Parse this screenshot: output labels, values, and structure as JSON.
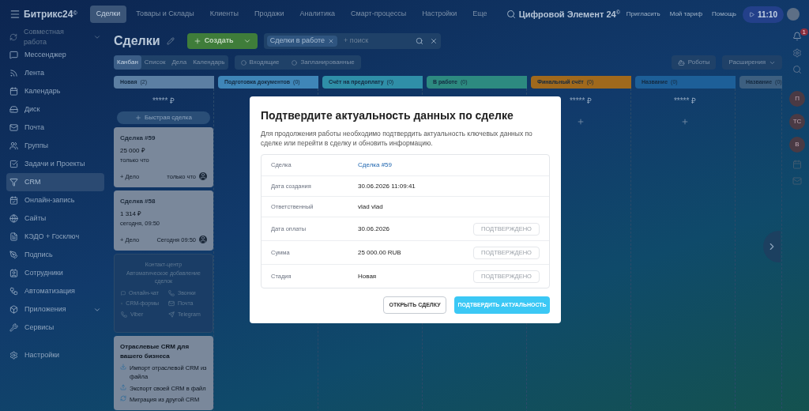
{
  "topbar": {
    "logo": "Битрикс24",
    "logo_mark": "©",
    "nav": [
      {
        "label": "Сделки",
        "selected": true
      },
      {
        "label": "Товары и Склады",
        "selected": false
      },
      {
        "label": "Клиенты",
        "selected": false
      },
      {
        "label": "Продажи",
        "selected": false
      },
      {
        "label": "Аналитика",
        "selected": false
      },
      {
        "label": "Смарт-процессы",
        "selected": false
      },
      {
        "label": "Настройки",
        "selected": false
      },
      {
        "label": "Еще",
        "selected": false
      }
    ],
    "company": "Цифровой Элемент 24",
    "company_mark": "©",
    "links": [
      "Пригласить",
      "Мой тариф",
      "Помощь"
    ],
    "time": "11:10"
  },
  "sidebar": {
    "group": "Совместная работа",
    "items": [
      {
        "label": "Мессенджер",
        "selected": false,
        "expandable": false
      },
      {
        "label": "Лента",
        "selected": false,
        "expandable": false
      },
      {
        "label": "Календарь",
        "selected": false,
        "expandable": false
      },
      {
        "label": "Диск",
        "selected": false,
        "expandable": false
      },
      {
        "label": "Почта",
        "selected": false,
        "expandable": false
      },
      {
        "label": "Группы",
        "selected": false,
        "expandable": false
      },
      {
        "label": "Задачи и Проекты",
        "selected": false,
        "expandable": false
      },
      {
        "label": "CRM",
        "selected": true,
        "expandable": false
      },
      {
        "label": "Онлайн-запись",
        "selected": false,
        "expandable": false
      },
      {
        "label": "Сайты",
        "selected": false,
        "expandable": false
      },
      {
        "label": "КЭДО + Госключ",
        "selected": false,
        "expandable": false
      },
      {
        "label": "Подпись",
        "selected": false,
        "expandable": false
      },
      {
        "label": "Сотрудники",
        "selected": false,
        "expandable": false
      },
      {
        "label": "Автоматизация",
        "selected": false,
        "expandable": false
      },
      {
        "label": "Приложения",
        "selected": false,
        "expandable": true
      },
      {
        "label": "Сервисы",
        "selected": false,
        "expandable": false
      }
    ],
    "settings": "Настройки"
  },
  "header": {
    "title": "Сделки",
    "create": "Создать",
    "filter_chip": "Сделки в работе",
    "search_placeholder": "+ поиск",
    "views": [
      {
        "label": "Канбан",
        "selected": true
      },
      {
        "label": "Список",
        "selected": false
      },
      {
        "label": "Дела",
        "selected": false
      },
      {
        "label": "Календарь",
        "selected": false
      }
    ],
    "counters": [
      "Входящие",
      "Запланированные"
    ],
    "robots": "Роботы",
    "extensions": "Расширения"
  },
  "stages": [
    {
      "name": "Новая",
      "count": "(2)",
      "color": "#5c7fa3",
      "sum": "***** ₽"
    },
    {
      "name": "Подготовка документов",
      "count": "(0)",
      "color": "#3f86b8"
    },
    {
      "name": "Счёт на предоплату",
      "count": "(0)",
      "color": "#2f8fa8"
    },
    {
      "name": "В работе",
      "count": "(0)",
      "color": "#2d8a80"
    },
    {
      "name": "Финальный счёт",
      "count": "(0)",
      "color": "#a0691c",
      "sum": "***** ₽"
    },
    {
      "name": "Название",
      "count": "(0)",
      "color": "#1d5f98",
      "sum": "***** ₽"
    },
    {
      "name": "Название",
      "count": "(0)",
      "color": "#3d5f80"
    }
  ],
  "quick_deal": "Быстрая сделка",
  "deals": [
    {
      "title": "Сделка #59",
      "amount": "25 000 ₽",
      "date": "только что",
      "add": "+ Дело",
      "time": "только что"
    },
    {
      "title": "Сделка #58",
      "amount": "1 314 ₽",
      "date": "сегодня, 09:50",
      "add": "+ Дело",
      "time": "Сегодня 09:50"
    }
  ],
  "contact_center": {
    "title": "Контакт-центр",
    "subtitle": "Автоматическое добавление сделок",
    "channels": [
      "Онлайн-чат",
      "Звонки",
      "CRM-формы",
      "Почта",
      "Viber",
      "Telegram"
    ]
  },
  "industry": {
    "title": "Отраслевые CRM для вашего бизнеса",
    "items": [
      "Импорт отраслевой CRM из файла",
      "Экспорт своей CRM в файл",
      "Миграция из другой CRM"
    ]
  },
  "right_rail": {
    "badge": "1",
    "avatars": [
      "П",
      "ТС",
      "В"
    ]
  },
  "dialog": {
    "title": "Подтвердите актуальность данных по сделке",
    "text": "Для продолжения работы необходимо подтвердить актуальность ключевых данных по сделке или перейти в сделку и обновить информацию.",
    "rows": [
      {
        "label": "Сделка",
        "value": "Сделка #59",
        "kind": "link"
      },
      {
        "label": "Дата создания",
        "value": "30.06.2026 11:09:41",
        "kind": "text"
      },
      {
        "label": "Ответственный",
        "value": "vlad vlad",
        "kind": "text"
      },
      {
        "label": "Дата оплаты",
        "value": "30.06.2026",
        "kind": "confirm",
        "confirm": "ПОДТВЕРЖДЕНО",
        "disabled": true
      },
      {
        "label": "Сумма",
        "value": "25 000.00 RUB",
        "kind": "confirm",
        "confirm": "ПОДТВЕРЖДЕНО",
        "disabled": true
      },
      {
        "label": "Стадия",
        "value": "Новая",
        "kind": "confirm",
        "confirm": "ПОДТВЕРЖДЕНО",
        "disabled": true
      }
    ],
    "secondary": "ОТКРЫТЬ СДЕЛКУ",
    "primary": "ПОДТВЕРДИТЬ АКТУАЛЬНОСТЬ"
  }
}
